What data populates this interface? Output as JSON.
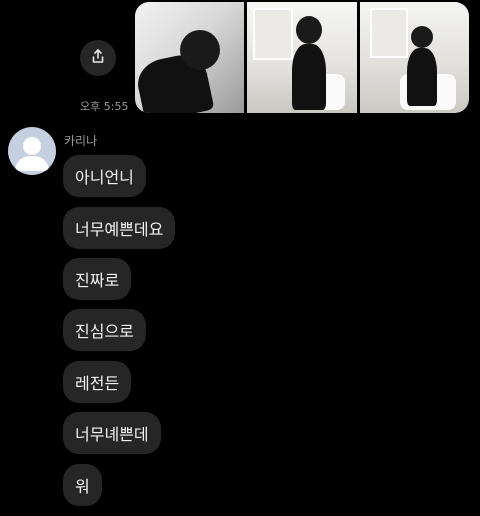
{
  "conversation": {
    "sent": {
      "timestamp": "오후 5:55",
      "share_icon": "share-icon"
    },
    "received": {
      "sender_name": "카리나",
      "avatar_icon": "default-avatar-icon",
      "messages": [
        "아니언니",
        "너무예쁜데요",
        "진짜로",
        "진심으로",
        "레전든",
        "너무녜쁜데",
        "워"
      ]
    }
  },
  "colors": {
    "background": "#000000",
    "bubble": "#262626",
    "meta_text": "#9a9a9a",
    "avatar": "#c4cfe0"
  }
}
